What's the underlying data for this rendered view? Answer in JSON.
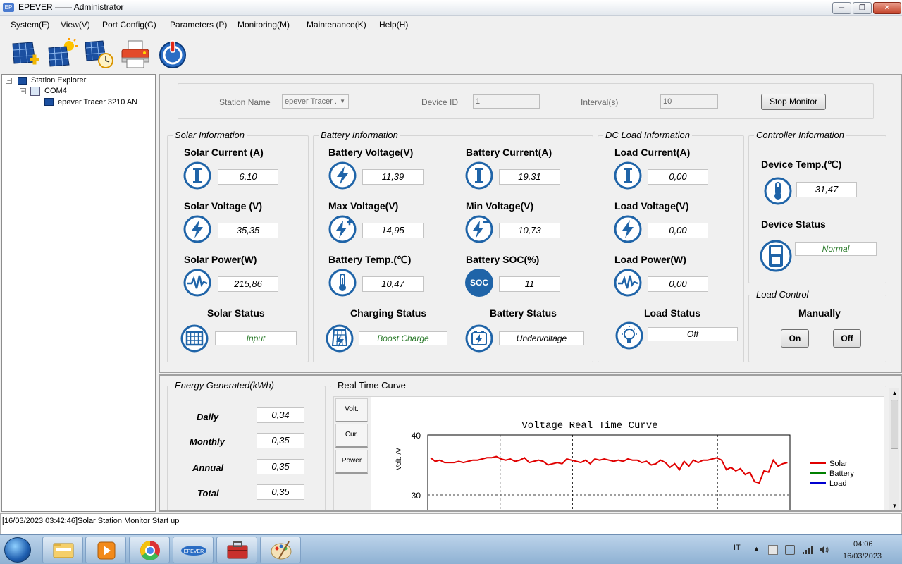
{
  "window": {
    "title": "EPEVER —— Administrator",
    "app_icon": "EP"
  },
  "menu": [
    "System(F)",
    "View(V)",
    "Port Config(C)",
    "Parameters (P)",
    "Monitoring(M)",
    "Maintenance(K)",
    "Help(H)"
  ],
  "toolbar": {
    "icons": [
      "add-station-icon",
      "solar-config-icon",
      "solar-clock-icon",
      "printer-icon",
      "power-icon"
    ]
  },
  "explorer": {
    "root": "Station Explorer",
    "port": "COM4",
    "device": "epever Tracer 3210 AN"
  },
  "monitor_bar": {
    "station_label": "Station Name",
    "station_value": "epever Tracer .",
    "device_id_label": "Device ID",
    "device_id_value": "1",
    "interval_label": "Interval(s)",
    "interval_value": "10",
    "stop_button": "Stop Monitor"
  },
  "solar": {
    "title": "Solar Information",
    "current_label": "Solar Current (A)",
    "current": "6,10",
    "voltage_label": "Solar Voltage (V)",
    "voltage": "35,35",
    "power_label": "Solar Power(W)",
    "power": "215,86",
    "status_label": "Solar Status",
    "status": "Input"
  },
  "battery": {
    "title": "Battery Information",
    "voltage_label": "Battery Voltage(V)",
    "voltage": "11,39",
    "current_label": "Battery Current(A)",
    "current": "19,31",
    "max_label": "Max Voltage(V)",
    "max": "14,95",
    "min_label": "Min Voltage(V)",
    "min": "10,73",
    "temp_label": "Battery Temp.(℃)",
    "temp": "10,47",
    "soc_label": "Battery SOC(%)",
    "soc": "11",
    "charging_label": "Charging Status",
    "charging": "Boost Charge",
    "status_label": "Battery Status",
    "status": "Undervoltage",
    "soc_icon_text": "SOC"
  },
  "load": {
    "title": "DC Load Information",
    "current_label": "Load Current(A)",
    "current": "0,00",
    "voltage_label": "Load Voltage(V)",
    "voltage": "0,00",
    "power_label": "Load Power(W)",
    "power": "0,00",
    "status_label": "Load Status",
    "status": "Off"
  },
  "controller": {
    "title": "Controller Information",
    "temp_label": "Device Temp.(℃)",
    "temp": "31,47",
    "status_label": "Device Status",
    "status": "Normal"
  },
  "load_control": {
    "title": "Load Control",
    "mode": "Manually",
    "on": "On",
    "off": "Off"
  },
  "energy": {
    "title": "Energy Generated(kWh)",
    "daily_label": "Daily",
    "daily": "0,34",
    "monthly_label": "Monthly",
    "monthly": "0,35",
    "annual_label": "Annual",
    "annual": "0,35",
    "total_label": "Total",
    "total": "0,35"
  },
  "curve": {
    "panel_title": "Real Time Curve",
    "tabs": [
      "Volt.",
      "Cur.",
      "Power"
    ]
  },
  "chart_data": {
    "type": "line",
    "title": "Voltage Real Time Curve",
    "ylabel": "Volt. /V",
    "xlabel": "",
    "yticks": [
      40,
      30
    ],
    "ylim": [
      24,
      40
    ],
    "grid": true,
    "legend_position": "right",
    "series": [
      {
        "name": "Solar",
        "color": "#e00000",
        "values": [
          36.2,
          35.6,
          35.8,
          35.4,
          35.4,
          35.4,
          35.6,
          35.4,
          35.6,
          35.8,
          35.8,
          36.0,
          36.2,
          36.2,
          36.4,
          36.0,
          35.8,
          36.0,
          35.6,
          35.8,
          36.2,
          35.4,
          35.6,
          35.8,
          35.6,
          35.0,
          35.2,
          35.4,
          35.2,
          36.0,
          35.8,
          35.6,
          35.4,
          35.8,
          35.2,
          36.0,
          35.8,
          36.0,
          35.8,
          35.6,
          35.8,
          35.6,
          36.0,
          35.8,
          35.8,
          35.4,
          35.6,
          35.0,
          35.2,
          35.8,
          35.4,
          34.6,
          35.2,
          34.2,
          35.6,
          34.8,
          35.8,
          35.4,
          35.8,
          35.8,
          36.0,
          36.2,
          35.8,
          34.2,
          34.6,
          34.0,
          34.4,
          33.4,
          33.8,
          32.2,
          32.0,
          34.0,
          33.8,
          35.8,
          34.8,
          35.2,
          35.4
        ]
      },
      {
        "name": "Battery",
        "color": "#008000",
        "values": []
      },
      {
        "name": "Load",
        "color": "#0000d0",
        "values": []
      }
    ]
  },
  "status_bar": {
    "message": "[16/03/2023 03:42:46]Solar Station Monitor Start up"
  },
  "taskbar": {
    "apps": [
      "explorer-icon",
      "media-player-icon",
      "chrome-icon",
      "epever-icon",
      "toolbox-icon",
      "paint-icon"
    ],
    "lang": "IT",
    "time": "04:06",
    "date": "16/03/2023"
  },
  "colors": {
    "icon_blue": "#1f64a8",
    "status_green": "#2a7a2a",
    "curve_red": "#e00000"
  }
}
